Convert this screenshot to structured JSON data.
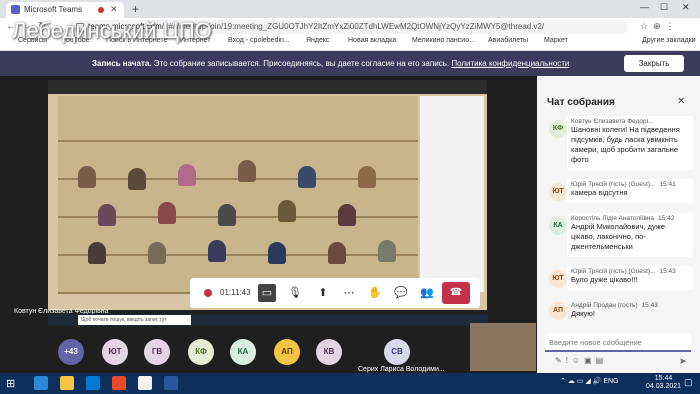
{
  "browser": {
    "tab_title": "Microsoft Teams",
    "url_host": "teams.microsoft.com",
    "url_path": "/_#/l/meetup-join/19:meeting_ZGU0OTJhY2ItZmYxZi00ZTdhLWEwM2QtOWNjYzQyYzZiMWY5@thread.v2/",
    "bookmarks": [
      "Сервисы",
      "YouTube",
      "Поиск в Интернете",
      "Интернет",
      "Вход - cpolebedin...",
      "Яндекс",
      "Новая вкладка",
      "Меликино пансио...",
      "Авиабилеты",
      "Маркет",
      "Другие закладки"
    ]
  },
  "watermark": "Лебединський ЦПО",
  "banner": {
    "bold": "Запись начата.",
    "text": " Это собрание записывается. Присоединяясь, вы даете согласие на его запись.",
    "link": "Политика конфиденциальности",
    "close_label": "Закрыть"
  },
  "stage": {
    "presenter_name": "Ковтун Єлизавета Федорівна",
    "timer": "01:11:43"
  },
  "inner_taskbar": {
    "search_placeholder": "Щоб почати пошук, введіть запит тут"
  },
  "participants": [
    {
      "initials": "+43"
    },
    {
      "initials": "ЮТ"
    },
    {
      "initials": "ГВ"
    },
    {
      "initials": "КФ"
    },
    {
      "initials": "КА"
    },
    {
      "initials": "АП"
    },
    {
      "initials": "КВ"
    },
    {
      "initials": "СВ",
      "name": "Серих Лариса Володими..."
    }
  ],
  "chat": {
    "title": "Чат собрания",
    "messages": [
      {
        "initials": "КФ",
        "sender": "Ковтун Єлизавета Федорі...",
        "time": "",
        "text": "Шановні колеги! На підведення підсумків, будь ласка увімкніть камери, щоб зробити загальне фото"
      },
      {
        "initials": "ЮТ",
        "sender": "Юрій Трясій (гість) (Guest)...",
        "time": "15:41",
        "text": "камера відсутня"
      },
      {
        "initials": "КА",
        "sender": "Коростіль Лідія Анатоліївна",
        "time": "15:42",
        "text": "Андрій Миколайович, дуже цікаво, лаконічно, по-джентельменськи"
      },
      {
        "initials": "ЮТ",
        "sender": "Юрій Трясій (гість) (Guest)...",
        "time": "15:43",
        "text": "Було дуже цікаво!!!"
      },
      {
        "initials": "АП",
        "sender": "Андрій Продан (гость)",
        "time": "15:43",
        "text": "Дякую!"
      }
    ],
    "input_placeholder": "Введите новое сообщение"
  },
  "taskbar": {
    "lang": "ENG",
    "time": "15:44",
    "date": "04.03.2021"
  }
}
